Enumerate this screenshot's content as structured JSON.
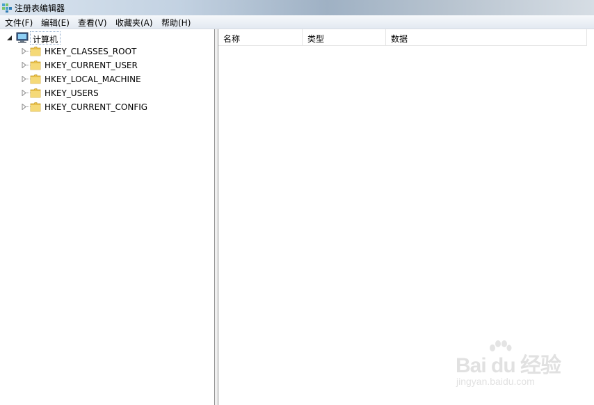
{
  "window": {
    "title": "注册表编辑器",
    "title_icon": "regedit-icon"
  },
  "menu": [
    {
      "label": "文件(F)"
    },
    {
      "label": "编辑(E)"
    },
    {
      "label": "查看(V)"
    },
    {
      "label": "收藏夹(A)"
    },
    {
      "label": "帮助(H)"
    }
  ],
  "tree": {
    "root": {
      "label": "计算机",
      "icon": "computer-icon",
      "expanded": true
    },
    "children": [
      {
        "label": "HKEY_CLASSES_ROOT",
        "icon": "folder-icon"
      },
      {
        "label": "HKEY_CURRENT_USER",
        "icon": "folder-icon"
      },
      {
        "label": "HKEY_LOCAL_MACHINE",
        "icon": "folder-icon"
      },
      {
        "label": "HKEY_USERS",
        "icon": "folder-icon"
      },
      {
        "label": "HKEY_CURRENT_CONFIG",
        "icon": "folder-icon"
      }
    ]
  },
  "list": {
    "columns": [
      {
        "label": "名称"
      },
      {
        "label": "类型"
      },
      {
        "label": "数据"
      }
    ]
  },
  "watermark": {
    "brand": "Bai du 经验",
    "url": "jingyan.baidu.com"
  },
  "colors": {
    "folder": "#f2d15f",
    "selection_border": "#8aa6c8",
    "pane_border": "#8e8f8f"
  }
}
